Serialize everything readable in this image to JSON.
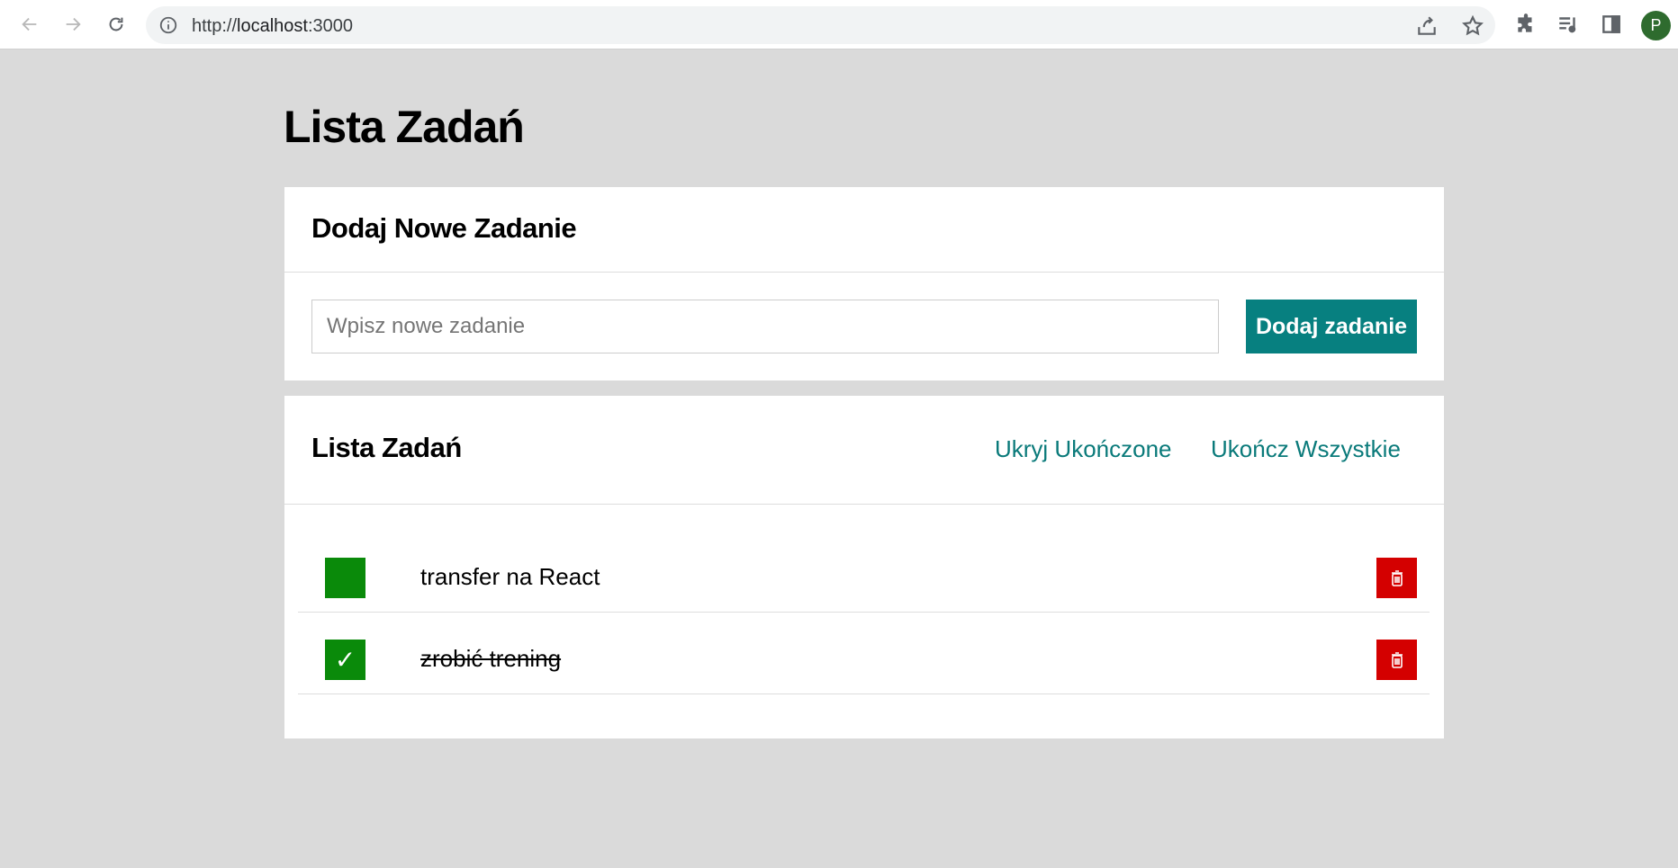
{
  "browser": {
    "url_scheme": "http://",
    "url_host": "localhost",
    "url_port": ":3000",
    "avatar_letter": "P",
    "icons": {
      "back": "back-arrow-icon",
      "forward": "forward-arrow-icon",
      "reload": "reload-icon",
      "info": "info-icon",
      "share": "share-icon",
      "bookmark": "star-icon",
      "extensions": "puzzle-icon",
      "media": "media-queue-icon",
      "side_panel": "side-panel-icon"
    }
  },
  "page": {
    "title": "Lista Zadań"
  },
  "add_card": {
    "title": "Dodaj Nowe Zadanie",
    "input_placeholder": "Wpisz nowe zadanie",
    "input_value": "",
    "add_button": "Dodaj zadanie"
  },
  "list_card": {
    "title": "Lista Zadań",
    "hide_completed": "Ukryj Ukończone",
    "complete_all": "Ukończ Wszystkie",
    "tasks": [
      {
        "text": "transfer na React",
        "done": false,
        "check_mark": ""
      },
      {
        "text": "zrobić trening",
        "done": true,
        "check_mark": "✓"
      }
    ]
  },
  "colors": {
    "accent": "#078080",
    "check_green": "#0a8a0a",
    "delete_red": "#d40000",
    "background": "#dadada"
  }
}
